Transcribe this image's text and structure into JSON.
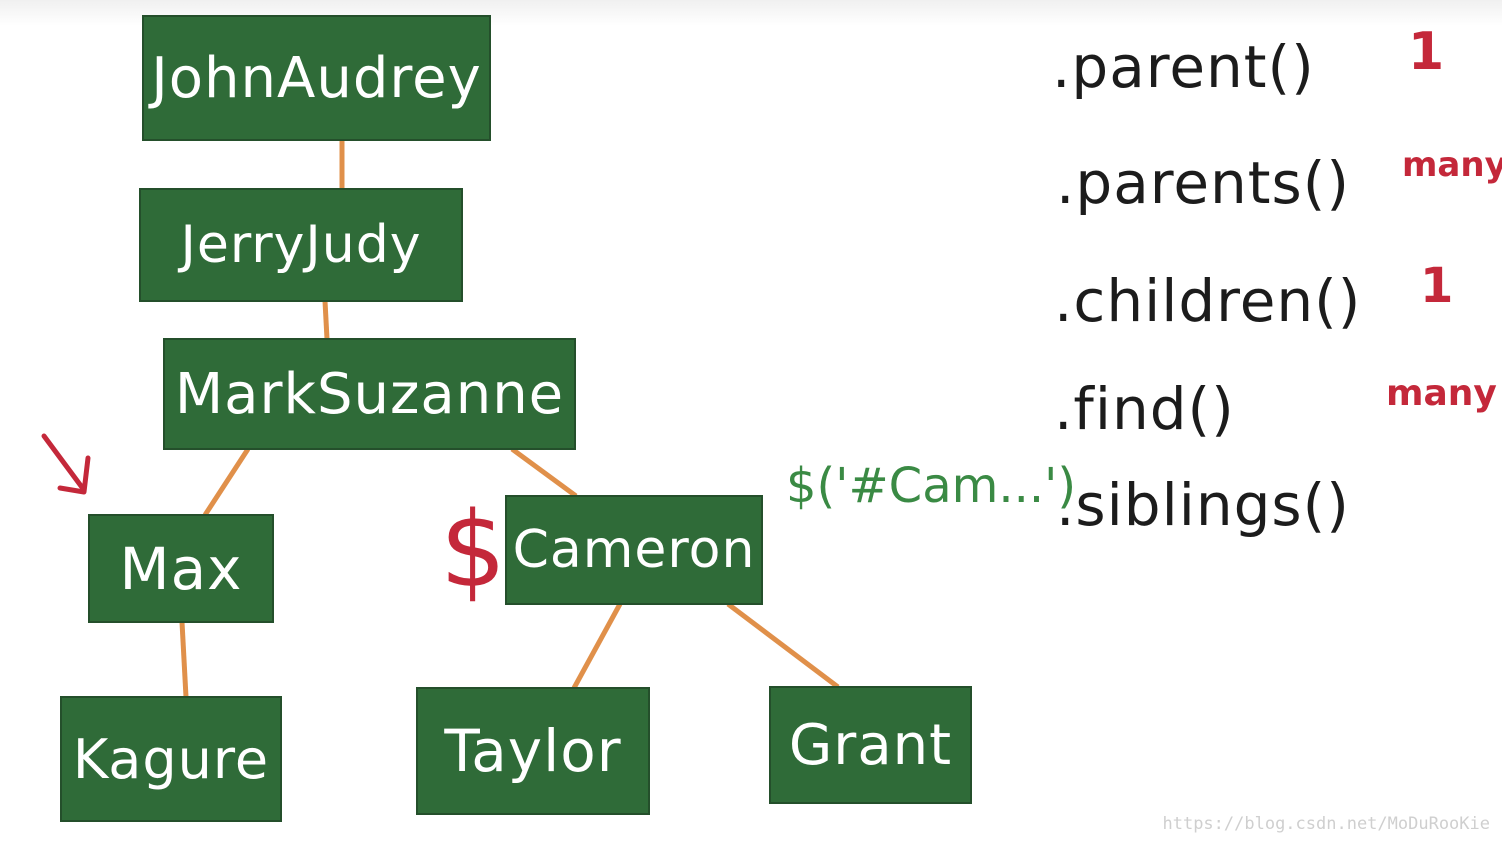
{
  "tree": {
    "nodes": [
      {
        "id": "john-audrey",
        "label": "JohnAudrey"
      },
      {
        "id": "jerry-judy",
        "label": "JerryJudy"
      },
      {
        "id": "mark-suzanne",
        "label": "MarkSuzanne"
      },
      {
        "id": "max",
        "label": "Max"
      },
      {
        "id": "cameron",
        "label": "Cameron"
      },
      {
        "id": "kagure",
        "label": "Kagure"
      },
      {
        "id": "taylor",
        "label": "Taylor"
      },
      {
        "id": "grant",
        "label": "Grant"
      }
    ],
    "edges": [
      [
        "john-audrey",
        "jerry-judy"
      ],
      [
        "jerry-judy",
        "mark-suzanne"
      ],
      [
        "mark-suzanne",
        "max"
      ],
      [
        "mark-suzanne",
        "cameron"
      ],
      [
        "max",
        "kagure"
      ],
      [
        "cameron",
        "taylor"
      ],
      [
        "cameron",
        "grant"
      ]
    ]
  },
  "annotations": {
    "dollar_sign": "$",
    "selector": "$('#Cam...')",
    "arrow": "down-left-arrow"
  },
  "methods": [
    {
      "name": ".parent()",
      "count": "1"
    },
    {
      "name": ".parents()",
      "count": "many"
    },
    {
      "name": ".children()",
      "count": "1"
    },
    {
      "name": ".find()",
      "count": "many"
    },
    {
      "name": ".siblings()",
      "count": ""
    }
  ],
  "watermark": "https://blog.csdn.net/MoDuRooKie",
  "colors": {
    "node_fill": "#2f6b38",
    "edge": "#e0904a",
    "annotation_red": "#c4283a",
    "selector_green": "#3a8a44",
    "method_text": "#1c1c1c"
  }
}
